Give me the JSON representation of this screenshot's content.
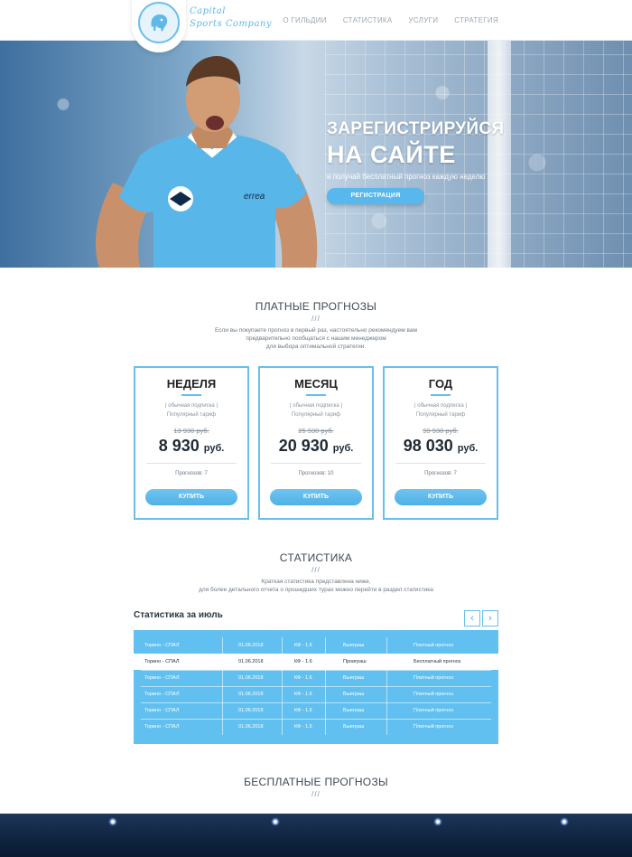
{
  "header": {
    "logo_line1": "Capital",
    "logo_line2": "Sports Company",
    "nav": [
      "О ГИЛЬДИИ",
      "СТАТИСТИКА",
      "УСЛУГИ",
      "СТРАТЕГИЯ"
    ]
  },
  "hero": {
    "title1": "ЗАРЕГИСТРИРУЙСЯ",
    "title2": "НА САЙТЕ",
    "subtitle": "и получай бесплатный прогноз каждую неделю",
    "button": "РЕГИСТРАЦИЯ"
  },
  "paid": {
    "title": "ПЛАТНЫЕ ПРОГНОЗЫ",
    "slash": "///",
    "desc_line1": "Если вы покупаете прогноз в первый раз, настоятельно рекомендуем вам",
    "desc_line2": "предварительно пообщаться с нашим менеджером",
    "desc_line3": "для выбора оптимальной стратегии.",
    "cards": [
      {
        "name": "НЕДЕЛЯ",
        "sub1": "( обычная подписка )",
        "sub2": "Популярный тариф",
        "old": "13 930 руб.",
        "price": "8 930",
        "currency": "руб.",
        "count": "Прогнозов: 7",
        "button": "КУПИТЬ"
      },
      {
        "name": "МЕСЯЦ",
        "sub1": "( обычная подписка )",
        "sub2": "Популярный тариф",
        "old": "25 930 руб.",
        "price": "20 930",
        "currency": "руб.",
        "count": "Прогнозов: 10",
        "button": "КУПИТЬ"
      },
      {
        "name": "ГОД",
        "sub1": "( обычная подписка )",
        "sub2": "Популярный тариф",
        "old": "99 930 руб.",
        "price": "98 030",
        "currency": "руб.",
        "count": "Прогнозов: 7",
        "button": "КУПИТЬ"
      }
    ]
  },
  "stats": {
    "title": "СТАТИСТИКА",
    "slash": "///",
    "desc_line1": "Краткая статистика представлена ниже,",
    "desc_line2": "для более детального отчета о прошедших турах можно перейти в раздел статистика",
    "table_title": "Статистика за июль",
    "prev": "‹",
    "next": "›",
    "rows": [
      {
        "match": "Торино - СПАЛ",
        "date": "01.06.2018",
        "coef": "КФ - 1.6",
        "result": "Выиграш",
        "type": "Платный прогноз",
        "alt": false
      },
      {
        "match": "Торино - СПАЛ",
        "date": "01.06.2018",
        "coef": "КФ - 1.6",
        "result": "Проиграш",
        "type": "Бесплатный прогноз",
        "alt": true
      },
      {
        "match": "Торино - СПАЛ",
        "date": "01.06.2018",
        "coef": "КФ - 1.6",
        "result": "Выиграш",
        "type": "Платный прогноз",
        "alt": false
      },
      {
        "match": "Торино - СПАЛ",
        "date": "01.06.2018",
        "coef": "КФ - 1.6",
        "result": "Выиграш",
        "type": "Платный прогноз",
        "alt": false
      },
      {
        "match": "Торино - СПАЛ",
        "date": "01.06.2018",
        "coef": "КФ - 1.6",
        "result": "Выиграш",
        "type": "Платный прогноз",
        "alt": false
      },
      {
        "match": "Торино - СПАЛ",
        "date": "01.06.2018",
        "coef": "КФ - 1.6",
        "result": "Выиграш",
        "type": "Платный прогноз",
        "alt": false
      }
    ]
  },
  "free": {
    "title": "БЕСПЛАТНЫЕ ПРОГНОЗЫ",
    "slash": "///"
  },
  "colors": {
    "accent": "#61c0f0",
    "text_dark": "#2b3640"
  }
}
